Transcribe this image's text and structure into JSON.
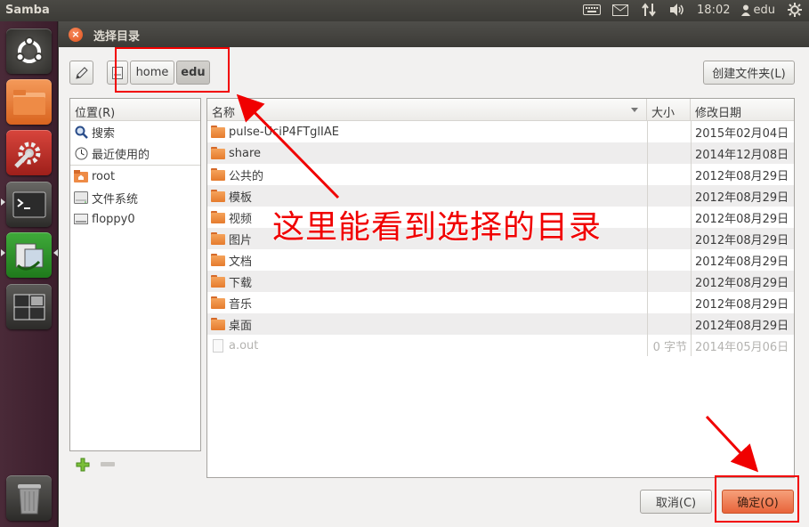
{
  "panel": {
    "app_title": "Samba",
    "time": "18:02",
    "user": "edu"
  },
  "dialog": {
    "title": "选择目录",
    "close_glyph": "×",
    "breadcrumb": [
      "home",
      "edu"
    ],
    "create_folder_label": "创建文件夹(L)",
    "cancel_label": "取消(C)",
    "ok_label": "确定(O)"
  },
  "places": {
    "header": "位置(R)",
    "items": [
      {
        "label": "搜索",
        "icon": "search-icon"
      },
      {
        "label": "最近使用的",
        "icon": "clock-icon"
      },
      {
        "label": "root",
        "icon": "home-folder-icon"
      },
      {
        "label": "文件系统",
        "icon": "drive-icon"
      },
      {
        "label": "floppy0",
        "icon": "floppy-icon"
      }
    ]
  },
  "filelist": {
    "columns": {
      "name": "名称",
      "size": "大小",
      "date": "修改日期"
    },
    "rows": [
      {
        "name": "pulse-UciP4FTglIAE",
        "size": "",
        "date": "2015年02月04日",
        "type": "folder"
      },
      {
        "name": "share",
        "size": "",
        "date": "2014年12月08日",
        "type": "folder"
      },
      {
        "name": "公共的",
        "size": "",
        "date": "2012年08月29日",
        "type": "folder"
      },
      {
        "name": "模板",
        "size": "",
        "date": "2012年08月29日",
        "type": "folder"
      },
      {
        "name": "视频",
        "size": "",
        "date": "2012年08月29日",
        "type": "folder"
      },
      {
        "name": "图片",
        "size": "",
        "date": "2012年08月29日",
        "type": "folder"
      },
      {
        "name": "文档",
        "size": "",
        "date": "2012年08月29日",
        "type": "folder"
      },
      {
        "name": "下载",
        "size": "",
        "date": "2012年08月29日",
        "type": "folder"
      },
      {
        "name": "音乐",
        "size": "",
        "date": "2012年08月29日",
        "type": "folder"
      },
      {
        "name": "桌面",
        "size": "",
        "date": "2012年08月29日",
        "type": "folder"
      },
      {
        "name": "a.out",
        "size": "0 字节",
        "date": "2014年05月06日",
        "type": "file"
      }
    ]
  },
  "annotation": {
    "text": "这里能看到选择的目录",
    "color": "#f00000"
  },
  "colors": {
    "accent": "#e0521b",
    "launcher": "#4a2a38",
    "panel": "#3c3b37"
  }
}
